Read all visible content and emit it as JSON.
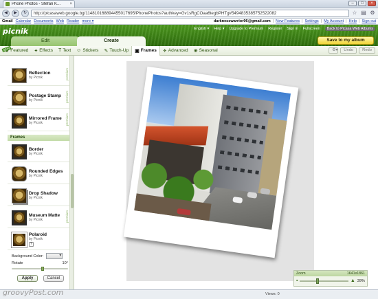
{
  "browser": {
    "tab_title": "Phone Photos - Stefan K...",
    "url": "http://picasaweb.google.bg/114810168894455017695/PhonePhotos?authkey=Gv1sRgCOaa6tegbPHTg#5494835385752522082"
  },
  "google_bar": {
    "links": [
      "Gmail",
      "Calendar",
      "Documents",
      "Web",
      "Reader",
      "more ▾"
    ],
    "email": "darknesswarrior96@gmail.com",
    "right_links": [
      "New Features",
      "Settings",
      "My Account",
      "Help",
      "Sign out"
    ]
  },
  "picnik": {
    "logo": "picnik",
    "header_links": [
      "English ▾",
      "Help ▾",
      "Upgrade to Premium",
      "Register",
      "Sign in",
      "Fullscreen",
      "Back to Picasa Web Albums"
    ],
    "tabs": {
      "edit": "Edit",
      "create": "Create"
    },
    "save_button": "Save to my album"
  },
  "toolbar": {
    "new_badge": "NEW",
    "tabs": [
      {
        "label": "Featured",
        "icon": "star-icon",
        "glyph": "★"
      },
      {
        "label": "Effects",
        "icon": "effects-icon",
        "glyph": "✦"
      },
      {
        "label": "Text",
        "icon": "text-icon",
        "glyph": "T"
      },
      {
        "label": "Stickers",
        "icon": "stickers-icon",
        "glyph": "☺"
      },
      {
        "label": "Touch-Up",
        "icon": "touchup-icon",
        "glyph": "✎"
      },
      {
        "label": "Frames",
        "icon": "frames-icon",
        "glyph": "▣"
      },
      {
        "label": "Advanced",
        "icon": "advanced-icon",
        "glyph": "✈"
      },
      {
        "label": "Seasonal",
        "icon": "seasonal-icon",
        "glyph": "❀"
      }
    ],
    "active_tab": "Frames",
    "undo": "Undo",
    "redo": "Redo"
  },
  "sidebar": {
    "top_items": [
      {
        "name": "Reflection",
        "by": "by Picnik",
        "premium": "premium"
      },
      {
        "name": "Postage Stamp",
        "by": "by Picnik",
        "premium": "premium"
      },
      {
        "name": "Mirrored Frame",
        "by": "by Picnik",
        "premium": "premium"
      }
    ],
    "section_title": "Frames",
    "frame_items": [
      {
        "name": "Border",
        "by": "by Picnik"
      },
      {
        "name": "Rounded Edges",
        "by": "by Picnik"
      },
      {
        "name": "Drop Shadow",
        "by": "by Picnik"
      },
      {
        "name": "Museum Matte",
        "by": "by Picnik",
        "premium": "premium"
      },
      {
        "name": "Polaroid",
        "by": "by Picnik"
      }
    ],
    "background_color_label": "Background Color:",
    "rotate_label": "Rotate",
    "rotate_value": "10°",
    "rotate_fraction": 0.55,
    "apply": "Apply",
    "cancel": "Cancel"
  },
  "zoom": {
    "label": "Zoom",
    "dimensions": "1641x1861",
    "percent": "39%",
    "level_fraction": 0.35
  },
  "status": {
    "views": "Views: 0"
  },
  "watermark": "groovyPost.com",
  "colors": {
    "accent_green": "#3f8a1a",
    "save_yellow": "#f2d538"
  }
}
